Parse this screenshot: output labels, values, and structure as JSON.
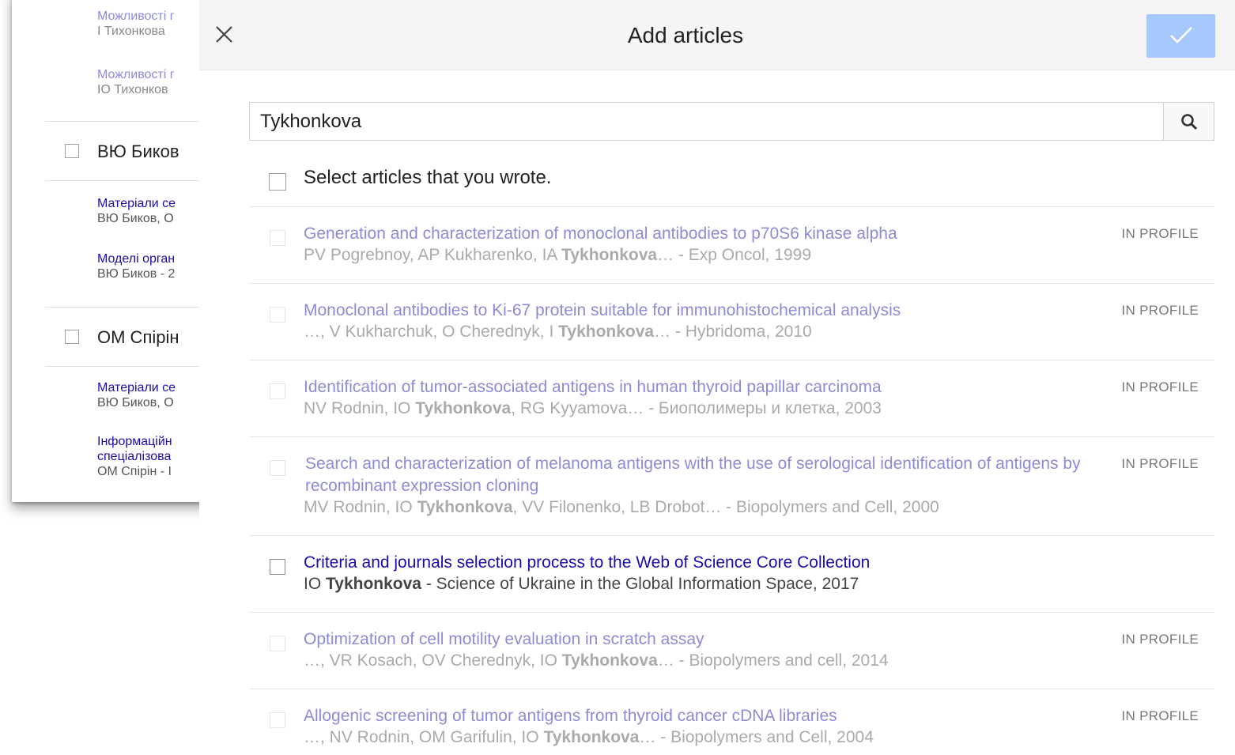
{
  "background": {
    "items": [
      {
        "title": "Можливості г",
        "authors": "І Тихонкова"
      },
      {
        "title": "Можливості г",
        "authors": "ІО Тихонков"
      }
    ],
    "author_groups": [
      {
        "name": "ВЮ Биков",
        "items": [
          {
            "title": "Матеріали се",
            "authors": "ВЮ Биков, О"
          },
          {
            "title": "Моделі орган",
            "authors": "ВЮ Биков - 2"
          }
        ]
      },
      {
        "name": "ОМ Спірін",
        "items": [
          {
            "title": "Матеріали се",
            "authors": "ВЮ Биков, О"
          },
          {
            "title_line1": "Інформаційн",
            "title_line2": "спеціалізова",
            "authors": "ОМ Спірін - І"
          }
        ]
      }
    ]
  },
  "dialog": {
    "title": "Add articles",
    "close_icon": "close-icon",
    "confirm_icon": "check-icon",
    "confirm_color": "#a6c8fd",
    "search": {
      "value": "Tykhonkova",
      "icon": "search-icon"
    },
    "select_all_label": "Select articles that you wrote.",
    "badge_label": "IN PROFILE",
    "articles": [
      {
        "title": "Generation and characterization of monoclonal antibodies to p70S6 kinase alpha",
        "meta_pre": "PV Pogrebnoy, AP Kukharenko, IA ",
        "meta_bold": "Tykhonkova",
        "meta_post": "… - Exp Oncol, 1999",
        "in_profile": true
      },
      {
        "title": "Monoclonal antibodies to Ki-67 protein suitable for immunohistochemical analysis",
        "meta_pre": "…, V Kukharchuk, O Cherednyk, I ",
        "meta_bold": "Tykhonkova",
        "meta_post": "… - Hybridoma, 2010",
        "in_profile": true
      },
      {
        "title": "Identification of tumor-associated antigens in human thyroid papillar carcinoma",
        "meta_pre": "NV Rodnin, IO ",
        "meta_bold": "Tykhonkova",
        "meta_post": ", RG Kyyamova… - Биополимеры и клетка, 2003",
        "in_profile": true
      },
      {
        "title": "Search and characterization of melanoma antigens with the use of serological identification of antigens by recombinant expression cloning",
        "meta_pre": "MV Rodnin, IO ",
        "meta_bold": "Tykhonkova",
        "meta_post": ", VV Filonenko, LB Drobot… - Biopolymers and Cell, 2000",
        "in_profile": true
      },
      {
        "title": "Criteria and journals selection process to the Web of Science Core Collection",
        "meta_pre": "IO ",
        "meta_bold": "Tykhonkova",
        "meta_post": " - Science of Ukraine in the Global Information Space, 2017",
        "in_profile": false
      },
      {
        "title": "Optimization of cell motility evaluation in scratch assay",
        "meta_pre": "…, VR Kosach, OV Cherednyk, IO ",
        "meta_bold": "Tykhonkova",
        "meta_post": "… - Biopolymers and cell, 2014",
        "in_profile": true
      },
      {
        "title": "Allogenic screening of tumor antigens from thyroid cancer cDNA libraries",
        "meta_pre": "…, NV Rodnin, OM Garifulin, IO ",
        "meta_bold": "Tykhonkova",
        "meta_post": "… - Biopolymers and Cell, 2004",
        "in_profile": true
      }
    ]
  }
}
